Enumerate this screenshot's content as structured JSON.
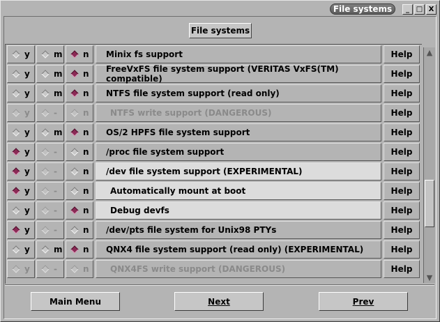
{
  "window": {
    "title": "File systems",
    "controls": [
      "_",
      "□",
      "X"
    ]
  },
  "header_button": "File systems",
  "rows": [
    {
      "y": "y",
      "m": "m",
      "n": "n",
      "label": "Minix fs support",
      "help": "Help",
      "state": "n",
      "disabled": false,
      "indent": false,
      "highlight": false
    },
    {
      "y": "y",
      "m": "m",
      "n": "n",
      "label": "FreeVxFS file system support (VERITAS VxFS(TM) compatible)",
      "help": "Help",
      "state": "n",
      "disabled": false,
      "indent": false,
      "highlight": false
    },
    {
      "y": "y",
      "m": "m",
      "n": "n",
      "label": "NTFS file system support (read only)",
      "help": "Help",
      "state": "n",
      "disabled": false,
      "indent": false,
      "highlight": false
    },
    {
      "y": "y",
      "m": "-",
      "n": "n",
      "label": "NTFS write support (DANGEROUS)",
      "help": "Help",
      "state": "none",
      "disabled": true,
      "indent": true,
      "highlight": false
    },
    {
      "y": "y",
      "m": "m",
      "n": "n",
      "label": "OS/2 HPFS file system support",
      "help": "Help",
      "state": "n",
      "disabled": false,
      "indent": false,
      "highlight": false
    },
    {
      "y": "y",
      "m": "-",
      "n": "n",
      "label": "/proc file system support",
      "help": "Help",
      "state": "y",
      "disabled": false,
      "indent": false,
      "highlight": false
    },
    {
      "y": "y",
      "m": "-",
      "n": "n",
      "label": "/dev file system support (EXPERIMENTAL)",
      "help": "Help",
      "state": "y",
      "disabled": false,
      "indent": false,
      "highlight": true
    },
    {
      "y": "y",
      "m": "-",
      "n": "n",
      "label": "Automatically mount at boot",
      "help": "Help",
      "state": "y",
      "disabled": false,
      "indent": true,
      "highlight": true
    },
    {
      "y": "y",
      "m": "-",
      "n": "n",
      "label": "Debug devfs",
      "help": "Help",
      "state": "n",
      "disabled": false,
      "indent": true,
      "highlight": true
    },
    {
      "y": "y",
      "m": "-",
      "n": "n",
      "label": "/dev/pts file system for Unix98 PTYs",
      "help": "Help",
      "state": "y",
      "disabled": false,
      "indent": false,
      "highlight": false
    },
    {
      "y": "y",
      "m": "m",
      "n": "n",
      "label": "QNX4 file system support (read only) (EXPERIMENTAL)",
      "help": "Help",
      "state": "n",
      "disabled": false,
      "indent": false,
      "highlight": false
    },
    {
      "y": "y",
      "m": "-",
      "n": "n",
      "label": "QNX4FS write support (DANGEROUS)",
      "help": "Help",
      "state": "none",
      "disabled": true,
      "indent": true,
      "highlight": false
    }
  ],
  "footer": {
    "main_menu": "Main Menu",
    "next": "Next",
    "prev": "Prev"
  },
  "colors": {
    "selected_diamond": "#8a2a55",
    "background": "#b4b4b4",
    "highlight_row": "#dcdcdc"
  },
  "icons": {
    "up_arrow": "scroll-up-icon",
    "down_arrow": "scroll-down-icon"
  }
}
